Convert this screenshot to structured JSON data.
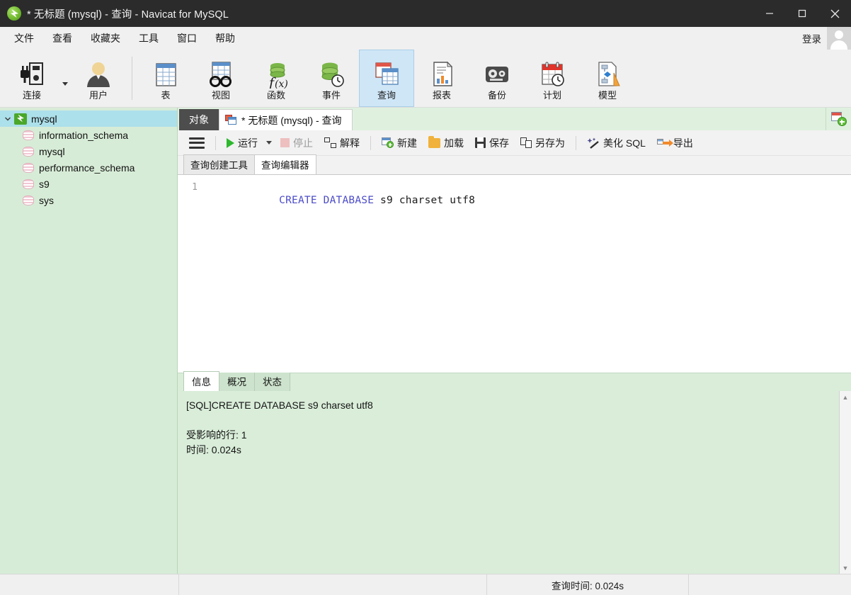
{
  "window": {
    "title": "* 无标题 (mysql) - 查询 - Navicat for MySQL",
    "app_icon": "navicat-logo-icon",
    "minimize": "minimize-icon",
    "maximize": "maximize-icon",
    "close": "close-icon"
  },
  "menubar": {
    "items": [
      {
        "label": "文件"
      },
      {
        "label": "查看"
      },
      {
        "label": "收藏夹"
      },
      {
        "label": "工具"
      },
      {
        "label": "窗口"
      },
      {
        "label": "帮助"
      }
    ],
    "login_label": "登录"
  },
  "toolbar": {
    "items": [
      {
        "label": "连接",
        "icon": "connection-icon",
        "has_dropdown": true,
        "active": false
      },
      {
        "label": "用户",
        "icon": "user-icon",
        "has_dropdown": false,
        "active": false
      },
      {
        "label": "表",
        "icon": "table-icon",
        "has_dropdown": false,
        "active": false
      },
      {
        "label": "视图",
        "icon": "view-glasses-icon",
        "has_dropdown": false,
        "active": false
      },
      {
        "label": "函数",
        "icon": "function-fx-icon",
        "has_dropdown": false,
        "active": false
      },
      {
        "label": "事件",
        "icon": "event-clock-icon",
        "has_dropdown": false,
        "active": false
      },
      {
        "label": "查询",
        "icon": "query-icon",
        "has_dropdown": false,
        "active": true
      },
      {
        "label": "报表",
        "icon": "report-icon",
        "has_dropdown": false,
        "active": false
      },
      {
        "label": "备份",
        "icon": "backup-tape-icon",
        "has_dropdown": false,
        "active": false
      },
      {
        "label": "计划",
        "icon": "schedule-calendar-icon",
        "has_dropdown": false,
        "active": false
      },
      {
        "label": "模型",
        "icon": "model-diagram-icon",
        "has_dropdown": false,
        "active": false
      }
    ]
  },
  "sidebar": {
    "connection": {
      "label": "mysql",
      "expanded": true,
      "selected": true
    },
    "databases": [
      {
        "label": "information_schema"
      },
      {
        "label": "mysql"
      },
      {
        "label": "performance_schema"
      },
      {
        "label": "s9"
      },
      {
        "label": "sys"
      }
    ]
  },
  "tabstrip": {
    "object_tab": "对象",
    "query_tab": "* 无标题 (mysql) - 查询",
    "add_tab_icon": "new-query-tab-icon"
  },
  "query_toolbar": {
    "menu_icon": "hamburger-menu-icon",
    "run_label": "运行",
    "stop_label": "停止",
    "explain_label": "解释",
    "new_label": "新建",
    "load_label": "加载",
    "save_label": "保存",
    "save_as_label": "另存为",
    "beautify_label": "美化 SQL",
    "export_label": "导出"
  },
  "editor_tabs": [
    {
      "label": "查询创建工具",
      "active": false
    },
    {
      "label": "查询编辑器",
      "active": true
    }
  ],
  "editor": {
    "lines": [
      {
        "number": "1",
        "tokens": [
          {
            "text": "CREATE DATABASE",
            "type": "keyword"
          },
          {
            "text": " s9 charset utf8",
            "type": "plain"
          }
        ]
      }
    ]
  },
  "results": {
    "tabs": [
      {
        "label": "信息",
        "active": true
      },
      {
        "label": "概况",
        "active": false
      },
      {
        "label": "状态",
        "active": false
      }
    ],
    "message": "[SQL]CREATE DATABASE s9 charset utf8\n\n受影响的行: 1\n时间: 0.024s",
    "scrollbar_up": "▲",
    "scrollbar_down": "▼"
  },
  "statusbar": {
    "segment1": "",
    "segment2": "",
    "segment3": "查询时间: 0.024s",
    "segment4": ""
  },
  "colors": {
    "titlebar_bg": "#2b2b2b",
    "toolbar_bg": "#f0f0f0",
    "sidebar_bg": "#d7ecd7",
    "sidebar_selection": "#ace0ea",
    "results_bg": "#d9edd9",
    "active_tool_bg": "#cfe6f7",
    "sql_keyword": "#4c4cc8",
    "run_green": "#2eb82e"
  }
}
